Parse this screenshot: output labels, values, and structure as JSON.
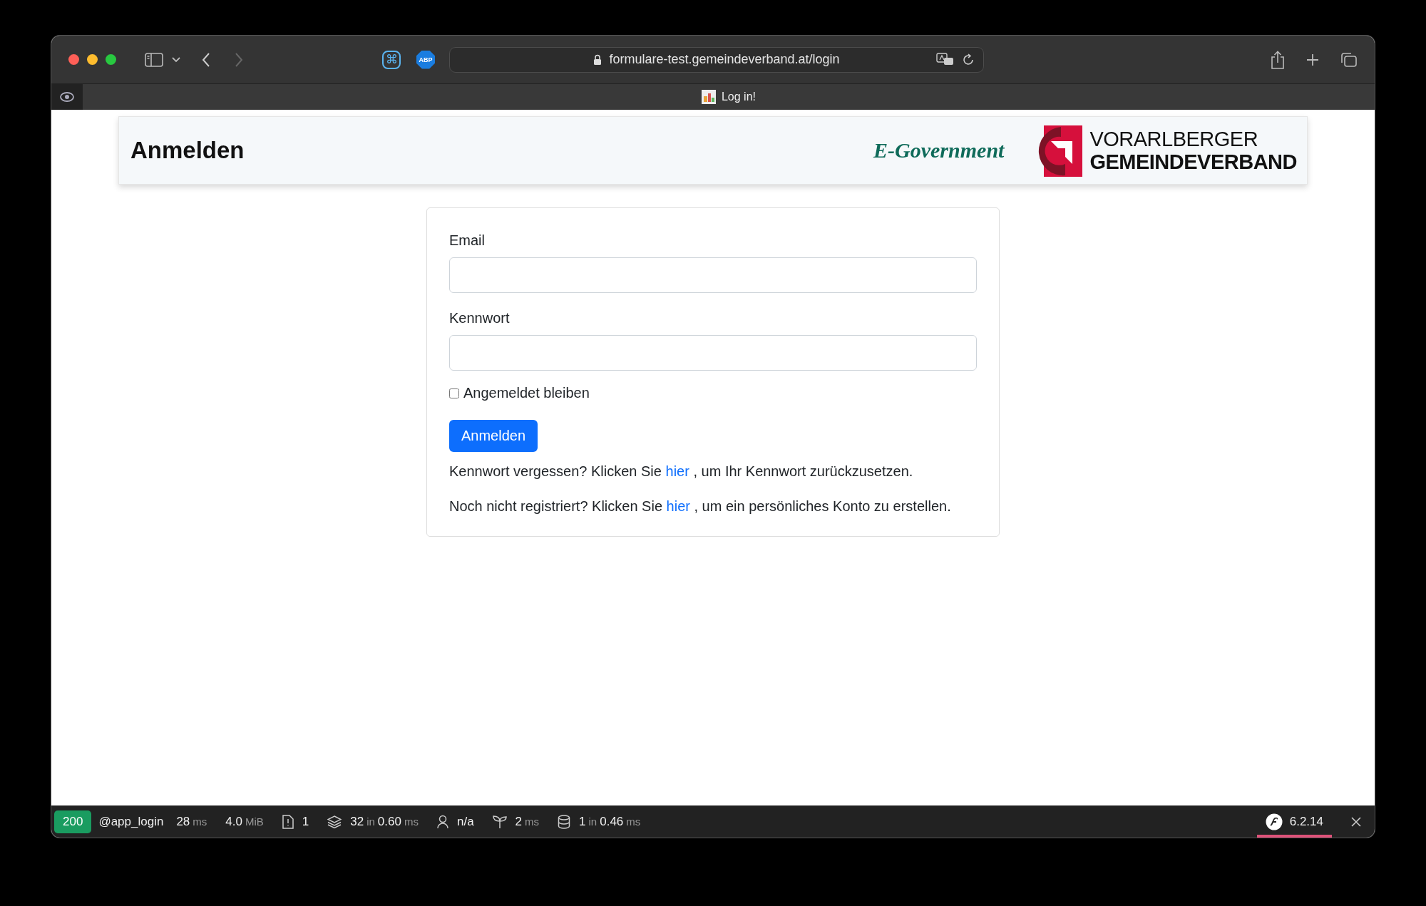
{
  "browser": {
    "extensions": [
      {
        "kind": "command",
        "glyph": "⌘"
      },
      {
        "kind": "adblock",
        "label": "ABP"
      }
    ],
    "url": "formulare-test.gemeindeverband.at/login",
    "tab": {
      "title": "Log in!"
    }
  },
  "header": {
    "title": "Anmelden",
    "tagline": "E-Government",
    "org_line_1": "VORARLBERGER",
    "org_line_2": "GEMEINDEVERBAND"
  },
  "form": {
    "fields": [
      {
        "label": "Email"
      },
      {
        "label": "Kennwort"
      }
    ],
    "remember": {
      "label": "Angemeldet bleiben",
      "checked": false
    },
    "submit": "Anmelden",
    "notes": [
      {
        "before": "Kennwort vergessen? Klicken Sie",
        "link": "hier",
        "after": ", um Ihr Kennwort zurückzusetzen."
      },
      {
        "before": "Noch nicht registriert? Klicken Sie",
        "link": "hier",
        "after": ", um ein persönliches Konto zu erstellen."
      }
    ]
  },
  "debug_bar": {
    "status": "200",
    "route": "@app_login",
    "items": [
      {
        "kind": "time",
        "value": "28",
        "unit": "ms"
      },
      {
        "kind": "memory",
        "value": "4.0",
        "unit": "MiB"
      },
      {
        "kind": "file",
        "value": "1"
      },
      {
        "kind": "layers",
        "value": "32",
        "joiner": "in",
        "time": "0.60",
        "unit": "ms"
      },
      {
        "kind": "user",
        "value": "n/a"
      },
      {
        "kind": "sprout",
        "value": "2",
        "unit": "ms"
      },
      {
        "kind": "database",
        "value": "1",
        "joiner": "in",
        "time": "0.46",
        "unit": "ms"
      }
    ],
    "version": "6.2.14"
  }
}
